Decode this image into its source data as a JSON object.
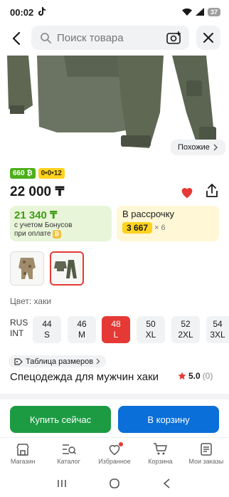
{
  "status": {
    "time": "00:02",
    "battery": "37"
  },
  "search": {
    "placeholder": "Поиск товара"
  },
  "gallery": {
    "similar_label": "Похожие"
  },
  "badges": {
    "bonus": "660 ₿",
    "installment": "0•0•12"
  },
  "product": {
    "price": "22 000 ₸",
    "title": "Спецодежда для мужчин хаки",
    "color_label": "Цвет: хаки",
    "rating": "5.0",
    "reviews": "(0)"
  },
  "bonus": {
    "amount": "21 340 ₸",
    "note_line1": "с учетом Бонусов",
    "note_line2": "при оплате"
  },
  "installment": {
    "title": "В рассрочку",
    "amount": "3 667",
    "multiplier": "× 6"
  },
  "sizes": {
    "header_top": "RUS",
    "header_bottom": "INT",
    "items": [
      {
        "rus": "44",
        "int": "S"
      },
      {
        "rus": "46",
        "int": "M"
      },
      {
        "rus": "48",
        "int": "L"
      },
      {
        "rus": "50",
        "int": "XL"
      },
      {
        "rus": "52",
        "int": "2XL"
      },
      {
        "rus": "54",
        "int": "3XL"
      }
    ],
    "selected_index": 2,
    "chart_label": "Таблица размеров"
  },
  "actions": {
    "buy_now": "Купить сейчас",
    "add_to_cart": "В корзину"
  },
  "nav": {
    "items": [
      {
        "label": "Магазин",
        "icon": "store-icon"
      },
      {
        "label": "Каталог",
        "icon": "catalog-icon"
      },
      {
        "label": "Избранное",
        "icon": "heart-icon"
      },
      {
        "label": "Корзина",
        "icon": "cart-icon"
      },
      {
        "label": "Мои заказы",
        "icon": "orders-icon"
      }
    ]
  },
  "colors": {
    "accent_red": "#e53935",
    "buy_green": "#1c9b43",
    "cart_blue": "#0a6fd8",
    "bonus_green": "#3f9d16",
    "installment_yellow": "#ffd21e"
  }
}
